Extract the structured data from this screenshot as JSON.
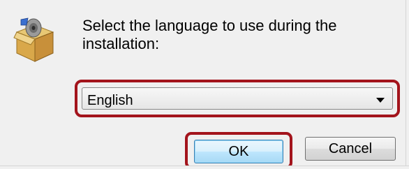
{
  "dialog": {
    "prompt": "Select the language to use during the\ninstallation:",
    "icon": "installer-box-icon"
  },
  "language_select": {
    "selected": "English",
    "arrow_icon": "chevron-down-icon"
  },
  "buttons": {
    "ok_label": "OK",
    "cancel_label": "Cancel"
  },
  "colors": {
    "highlight": "#a3141c",
    "background": "#f0f0f0"
  }
}
